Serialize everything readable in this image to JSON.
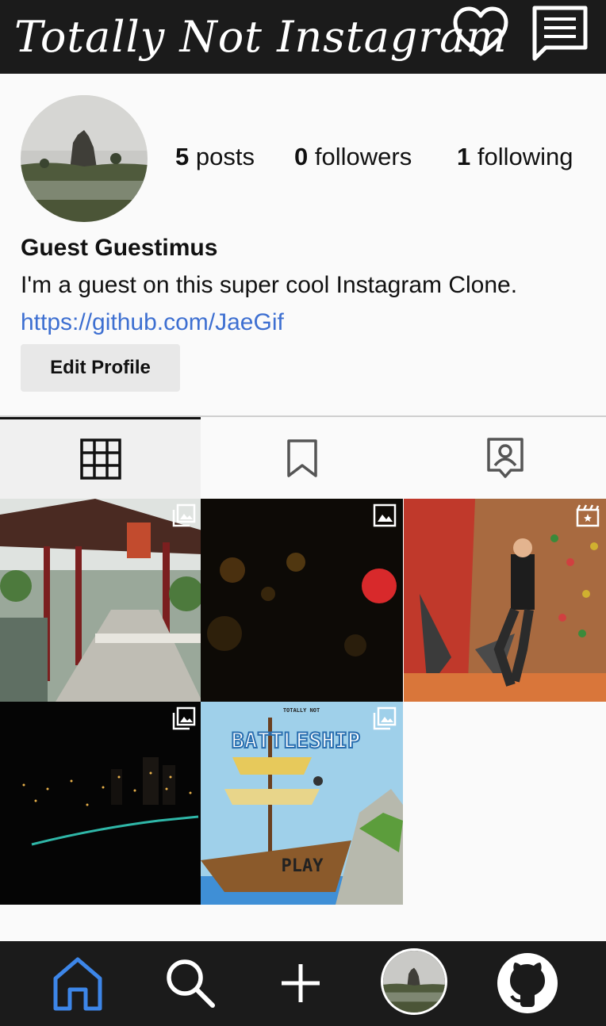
{
  "header": {
    "brand": "Totally Not Instagram",
    "icons": [
      "heart-icon",
      "message-icon"
    ]
  },
  "profile": {
    "posts_count": "5",
    "posts_label": "posts",
    "followers_count": "0",
    "followers_label": "followers",
    "following_count": "1",
    "following_label": "following",
    "name": "Guest Guestimus",
    "bio": "I'm a guest on this super cool Instagram Clone.",
    "link": "https://github.com/JaeGif",
    "edit_label": "Edit Profile"
  },
  "tabs": [
    {
      "icon": "grid-icon",
      "active": true
    },
    {
      "icon": "bookmark-icon",
      "active": false
    },
    {
      "icon": "tagged-icon",
      "active": false
    }
  ],
  "posts": [
    {
      "kind": "pagoda-corridor",
      "badge": "gallery-icon"
    },
    {
      "kind": "night-bokeh",
      "badge": "image-icon"
    },
    {
      "kind": "climbing-wall",
      "badge": "video-icon"
    },
    {
      "kind": "night-city",
      "badge": "gallery-icon"
    },
    {
      "kind": "battleship-game",
      "badge": "gallery-icon",
      "title_small": "TOTALLY NOT",
      "title": "BATTLESHIP",
      "play": "PLAY"
    }
  ],
  "colors": {
    "bar": "#1b1b1b",
    "link": "#3d6fd1",
    "home_active": "#3d86e8"
  },
  "bottom_nav": [
    "home-icon",
    "search-icon",
    "plus-icon",
    "profile-avatar",
    "github-icon"
  ]
}
